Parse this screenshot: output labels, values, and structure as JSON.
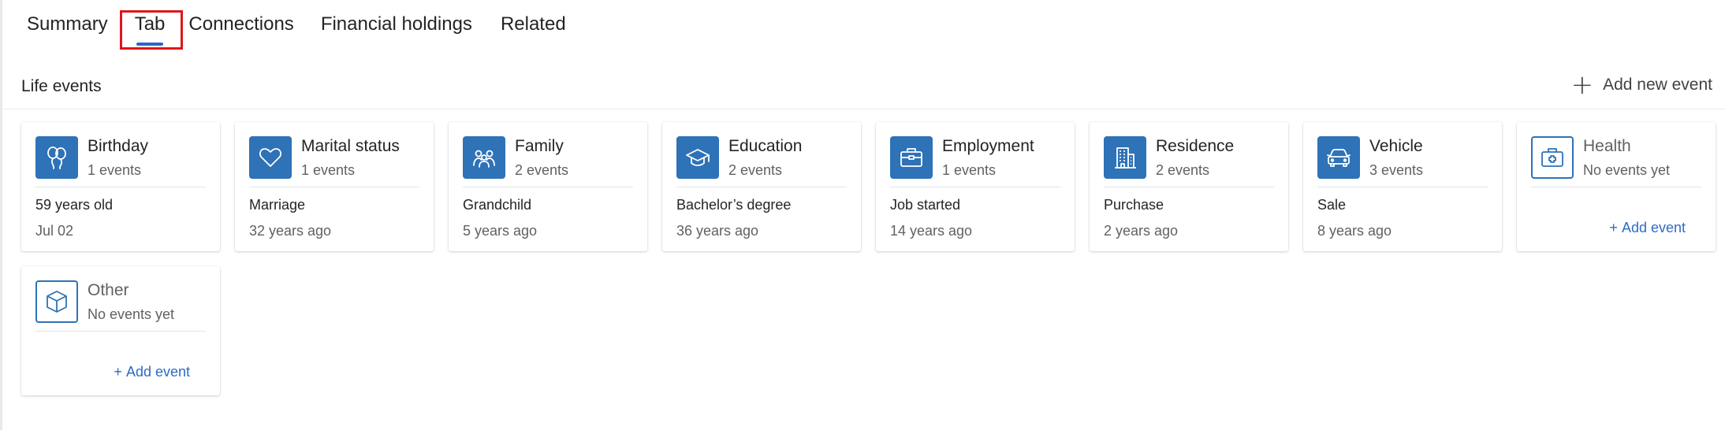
{
  "tabs": [
    {
      "label": "Summary",
      "active": false
    },
    {
      "label": "Tab",
      "active": true
    },
    {
      "label": "Connections",
      "active": false
    },
    {
      "label": "Financial holdings",
      "active": false
    },
    {
      "label": "Related",
      "active": false
    }
  ],
  "section": {
    "title": "Life events",
    "add_new_label": "Add new event"
  },
  "cards": [
    {
      "title": "Birthday",
      "count": "1 events",
      "detail": "59 years old",
      "time": "Jul 02",
      "icon": "balloons-icon"
    },
    {
      "title": "Marital status",
      "count": "1 events",
      "detail": "Marriage",
      "time": "32 years ago",
      "icon": "heart-icon"
    },
    {
      "title": "Family",
      "count": "2 events",
      "detail": "Grandchild",
      "time": "5 years ago",
      "icon": "people-icon"
    },
    {
      "title": "Education",
      "count": "2 events",
      "detail": "Bachelor’s degree",
      "time": "36 years ago",
      "icon": "graduation-cap-icon"
    },
    {
      "title": "Employment",
      "count": "1 events",
      "detail": "Job started",
      "time": "14 years ago",
      "icon": "briefcase-icon"
    },
    {
      "title": "Residence",
      "count": "2 events",
      "detail": "Purchase",
      "time": "2 years ago",
      "icon": "building-icon"
    },
    {
      "title": "Vehicle",
      "count": "3 events",
      "detail": "Sale",
      "time": "8 years ago",
      "icon": "car-icon"
    },
    {
      "title": "Health",
      "count": "No events yet",
      "add_label": "Add event",
      "icon": "medical-kit-icon"
    },
    {
      "title": "Other",
      "count": "No events yet",
      "add_label": "Add event",
      "icon": "cube-icon"
    }
  ],
  "colors": {
    "accent": "#2e72b8",
    "tab_underline": "#2b66c9",
    "link": "#2e6bc2",
    "highlight": "#e0161b"
  }
}
